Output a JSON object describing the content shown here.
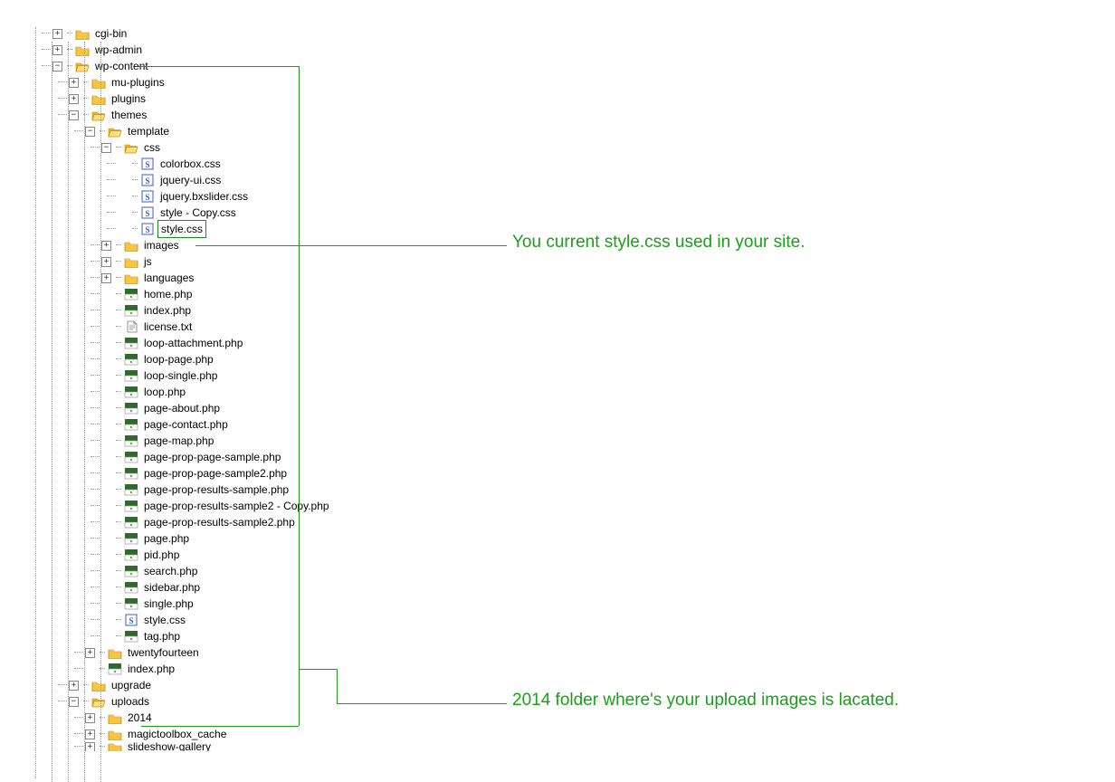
{
  "annotations": {
    "style_css": "You current style.css used in your site.",
    "uploads_2014": "2014 folder where's your upload images is lacated."
  },
  "tree": [
    {
      "depth": 0,
      "toggle": "+",
      "icon": "folder-closed",
      "label": "cgi-bin"
    },
    {
      "depth": 0,
      "toggle": "+",
      "icon": "folder-closed",
      "label": "wp-admin"
    },
    {
      "depth": 0,
      "toggle": "-",
      "icon": "folder-open",
      "label": "wp-content"
    },
    {
      "depth": 1,
      "toggle": "+",
      "icon": "folder-closed",
      "label": "mu-plugins"
    },
    {
      "depth": 1,
      "toggle": "+",
      "icon": "folder-closed",
      "label": "plugins"
    },
    {
      "depth": 1,
      "toggle": "-",
      "icon": "folder-open",
      "label": "themes"
    },
    {
      "depth": 2,
      "toggle": "-",
      "icon": "folder-open",
      "label": "template"
    },
    {
      "depth": 3,
      "toggle": "-",
      "icon": "folder-open",
      "label": "css"
    },
    {
      "depth": 4,
      "toggle": "",
      "icon": "css",
      "label": "colorbox.css"
    },
    {
      "depth": 4,
      "toggle": "",
      "icon": "css",
      "label": "jquery-ui.css"
    },
    {
      "depth": 4,
      "toggle": "",
      "icon": "css",
      "label": "jquery.bxslider.css"
    },
    {
      "depth": 4,
      "toggle": "",
      "icon": "css",
      "label": "style - Copy.css"
    },
    {
      "depth": 4,
      "toggle": "",
      "icon": "css",
      "label": "style.css",
      "selected": true
    },
    {
      "depth": 3,
      "toggle": "+",
      "icon": "folder-closed",
      "label": "images"
    },
    {
      "depth": 3,
      "toggle": "+",
      "icon": "folder-closed",
      "label": "js"
    },
    {
      "depth": 3,
      "toggle": "+",
      "icon": "folder-closed",
      "label": "languages"
    },
    {
      "depth": 3,
      "toggle": "",
      "icon": "php",
      "label": "home.php"
    },
    {
      "depth": 3,
      "toggle": "",
      "icon": "php",
      "label": "index.php"
    },
    {
      "depth": 3,
      "toggle": "",
      "icon": "txt",
      "label": "license.txt"
    },
    {
      "depth": 3,
      "toggle": "",
      "icon": "php",
      "label": "loop-attachment.php"
    },
    {
      "depth": 3,
      "toggle": "",
      "icon": "php",
      "label": "loop-page.php"
    },
    {
      "depth": 3,
      "toggle": "",
      "icon": "php",
      "label": "loop-single.php"
    },
    {
      "depth": 3,
      "toggle": "",
      "icon": "php",
      "label": "loop.php"
    },
    {
      "depth": 3,
      "toggle": "",
      "icon": "php",
      "label": "page-about.php"
    },
    {
      "depth": 3,
      "toggle": "",
      "icon": "php",
      "label": "page-contact.php"
    },
    {
      "depth": 3,
      "toggle": "",
      "icon": "php",
      "label": "page-map.php"
    },
    {
      "depth": 3,
      "toggle": "",
      "icon": "php",
      "label": "page-prop-page-sample.php"
    },
    {
      "depth": 3,
      "toggle": "",
      "icon": "php",
      "label": "page-prop-page-sample2.php"
    },
    {
      "depth": 3,
      "toggle": "",
      "icon": "php",
      "label": "page-prop-results-sample.php"
    },
    {
      "depth": 3,
      "toggle": "",
      "icon": "php",
      "label": "page-prop-results-sample2 - Copy.php"
    },
    {
      "depth": 3,
      "toggle": "",
      "icon": "php",
      "label": "page-prop-results-sample2.php"
    },
    {
      "depth": 3,
      "toggle": "",
      "icon": "php",
      "label": "page.php"
    },
    {
      "depth": 3,
      "toggle": "",
      "icon": "php",
      "label": "pid.php"
    },
    {
      "depth": 3,
      "toggle": "",
      "icon": "php",
      "label": "search.php"
    },
    {
      "depth": 3,
      "toggle": "",
      "icon": "php",
      "label": "sidebar.php"
    },
    {
      "depth": 3,
      "toggle": "",
      "icon": "php",
      "label": "single.php"
    },
    {
      "depth": 3,
      "toggle": "",
      "icon": "css",
      "label": "style.css"
    },
    {
      "depth": 3,
      "toggle": "",
      "icon": "php",
      "label": "tag.php"
    },
    {
      "depth": 2,
      "toggle": "+",
      "icon": "folder-closed",
      "label": "twentyfourteen"
    },
    {
      "depth": 2,
      "toggle": "",
      "icon": "php",
      "label": "index.php"
    },
    {
      "depth": 1,
      "toggle": "+",
      "icon": "folder-closed",
      "label": "upgrade"
    },
    {
      "depth": 1,
      "toggle": "-",
      "icon": "folder-open",
      "label": "uploads"
    },
    {
      "depth": 2,
      "toggle": "+",
      "icon": "folder-closed",
      "label": "2014"
    },
    {
      "depth": 2,
      "toggle": "+",
      "icon": "folder-closed",
      "label": "magictoolbox_cache"
    },
    {
      "depth": 2,
      "toggle": "+",
      "icon": "folder-closed",
      "label": "slideshow-gallery",
      "cut": true
    }
  ],
  "icons": {
    "folder-closed": "folder-closed-icon",
    "folder-open": "folder-open-icon",
    "css": "css-file-icon",
    "php": "php-file-icon",
    "txt": "txt-file-icon"
  }
}
